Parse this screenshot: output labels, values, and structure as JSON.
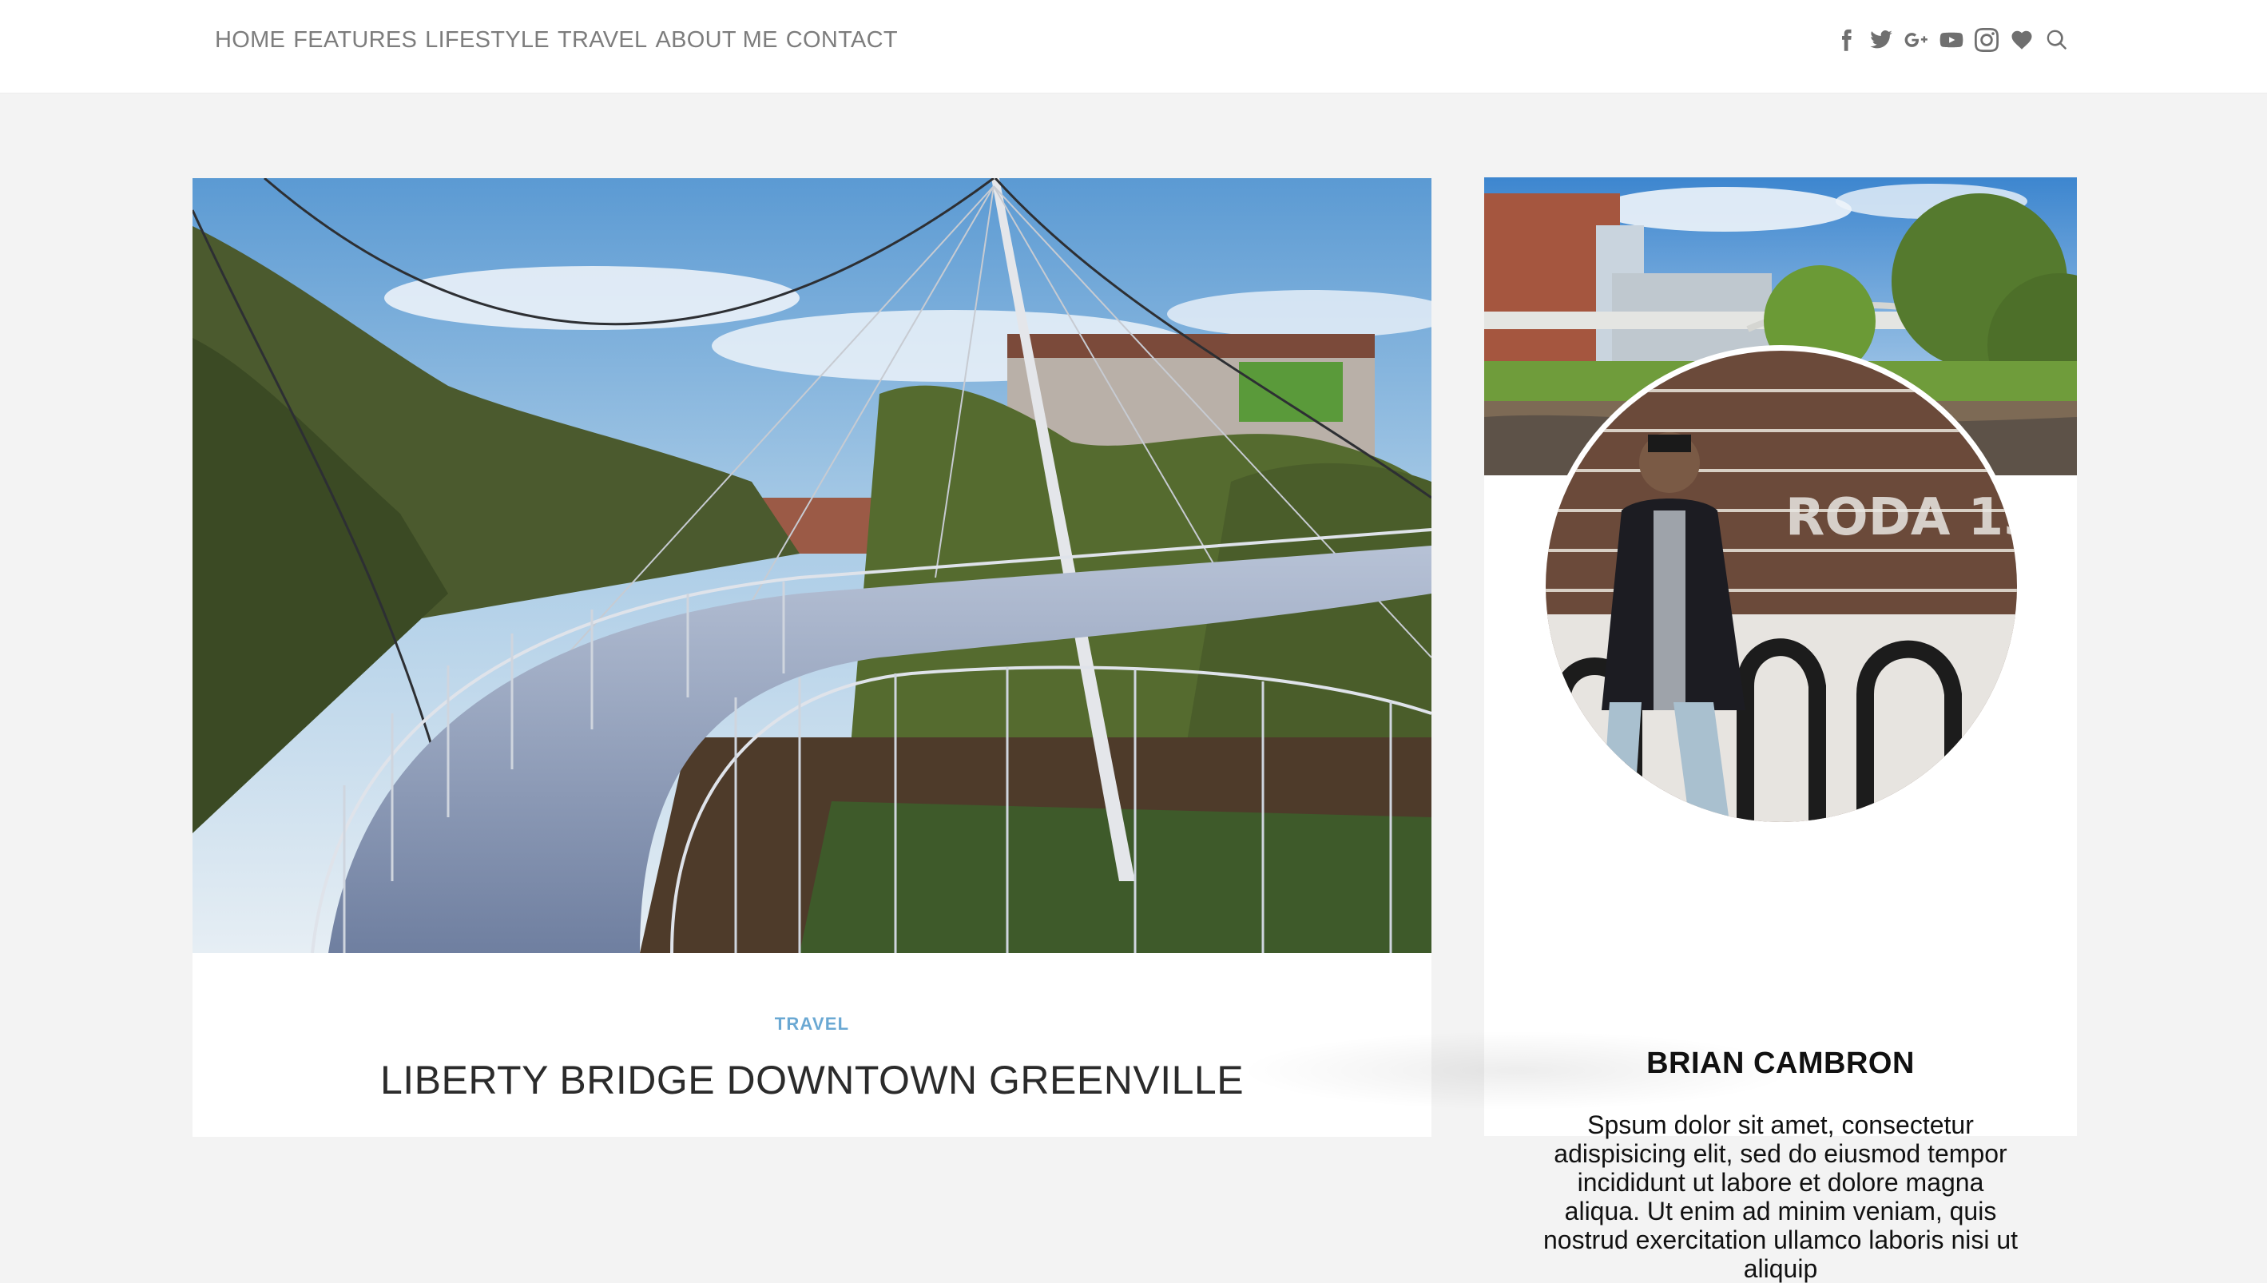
{
  "nav": {
    "items": [
      {
        "label": "HOME"
      },
      {
        "label": "FEATURES"
      },
      {
        "label": "LIFESTYLE"
      },
      {
        "label": "TRAVEL"
      },
      {
        "label": "ABOUT ME"
      },
      {
        "label": "CONTACT"
      }
    ]
  },
  "social_icons": [
    "facebook-icon",
    "twitter-icon",
    "google-plus-icon",
    "youtube-icon",
    "instagram-icon",
    "heart-icon",
    "search-icon"
  ],
  "post": {
    "category": "TRAVEL",
    "title": "LIBERTY BRIDGE DOWNTOWN GREENVILLE"
  },
  "about": {
    "name": "BRIAN CAMBRON",
    "bio": "Spsum dolor sit amet, consectetur adispisicing elit, sed do eiusmod tempor incididunt ut labore et dolore magna aliqua. Ut enim ad minim veniam, quis nostrud exercitation ullamco laboris nisi ut aliquip"
  },
  "colors": {
    "page_bg": "#f3f3f3",
    "nav_text": "#7d7d7d",
    "category": "#6aa8d3",
    "title_text": "#2b2b2b"
  }
}
